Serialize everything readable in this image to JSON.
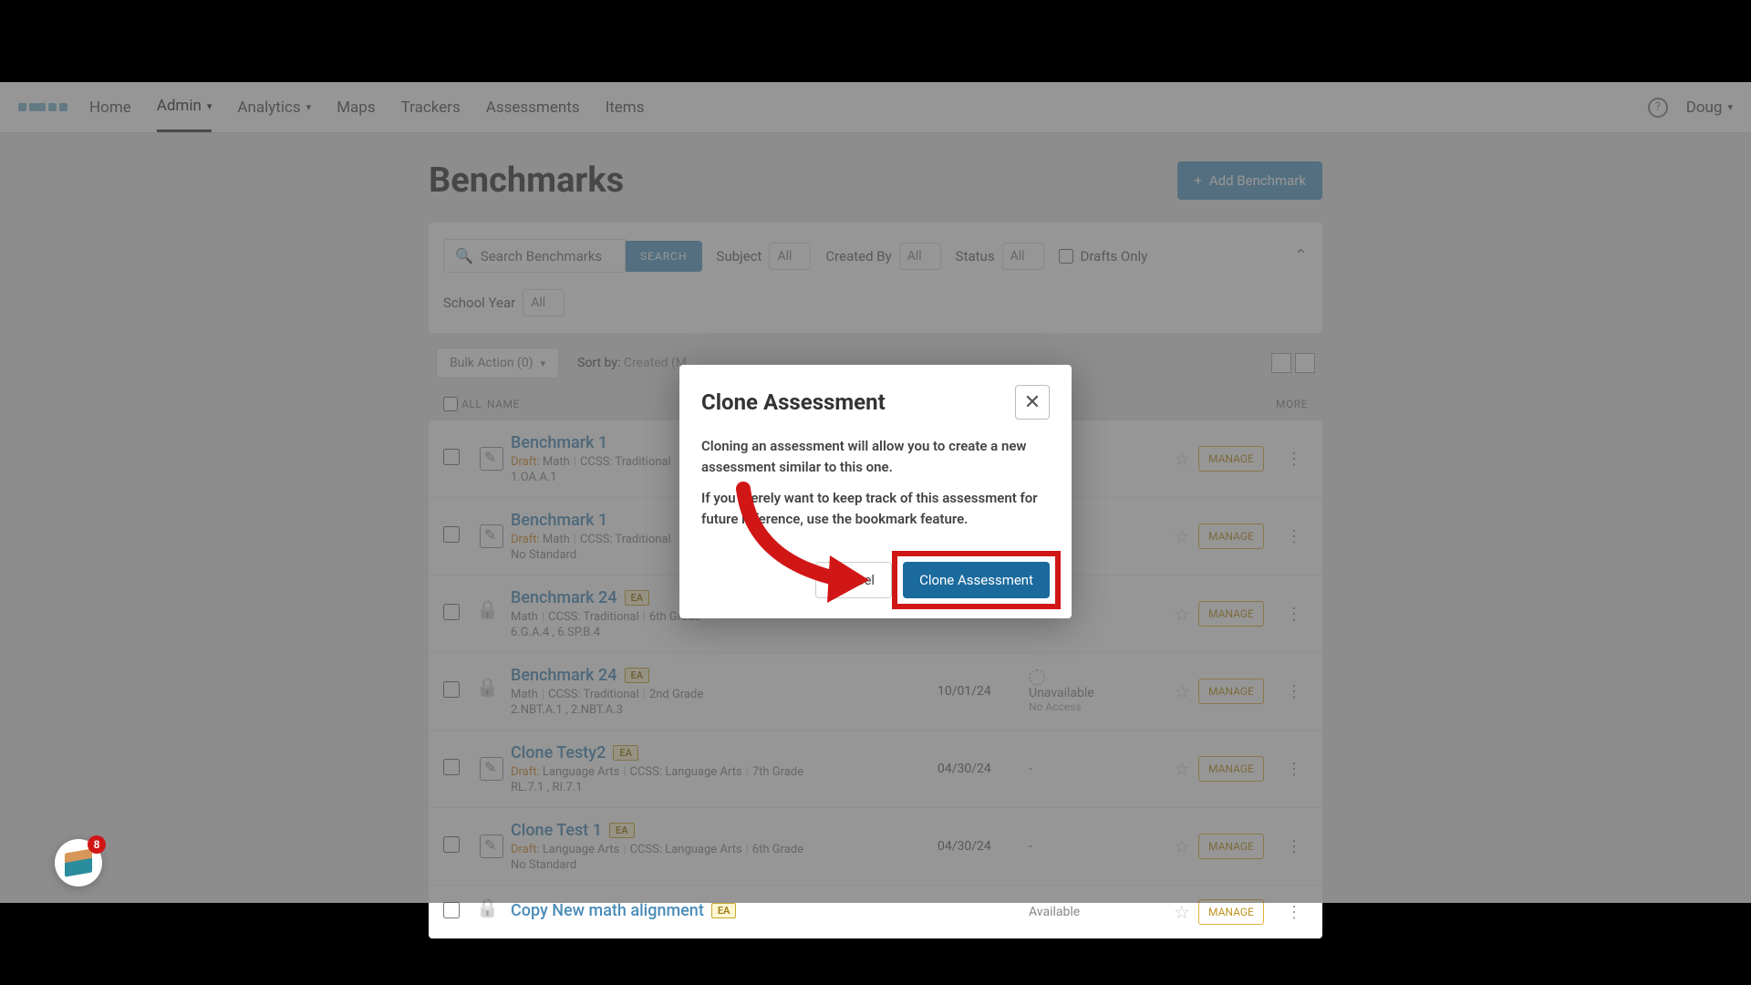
{
  "nav": {
    "items": [
      "Home",
      "Admin",
      "Analytics",
      "Maps",
      "Trackers",
      "Assessments",
      "Items"
    ],
    "activeIndex": 1,
    "user": "Doug"
  },
  "page": {
    "title": "Benchmarks",
    "addButton": "Add Benchmark"
  },
  "filters": {
    "searchPlaceholder": "Search Benchmarks",
    "searchButton": "SEARCH",
    "subjectLabel": "Subject",
    "subjectValue": "All",
    "createdByLabel": "Created By",
    "createdByValue": "All",
    "statusLabel": "Status",
    "statusValue": "All",
    "draftsOnly": "Drafts Only",
    "schoolYearLabel": "School Year",
    "schoolYearValue": "All"
  },
  "actionbar": {
    "bulkAction": "Bulk Action (0)",
    "sortByLabel": "Sort by:",
    "sortByValue": "Created (M..."
  },
  "tableHeader": {
    "all": "ALL",
    "name": "NAME",
    "more": "MORE"
  },
  "rows": [
    {
      "title": "Benchmark 1",
      "draft": true,
      "ea": false,
      "meta": "Math",
      "ccss": "CCSS: Traditional",
      "grade": "",
      "tags": "1.OA.A.1",
      "date": "",
      "status": "",
      "lockIcon": false
    },
    {
      "title": "Benchmark 1",
      "draft": true,
      "ea": false,
      "meta": "Math",
      "ccss": "CCSS: Traditional",
      "grade": "",
      "tags": "No Standard",
      "date": "",
      "status": "",
      "lockIcon": false
    },
    {
      "title": "Benchmark 24",
      "draft": false,
      "ea": true,
      "meta": "Math",
      "ccss": "CCSS: Traditional",
      "grade": "6th Grade",
      "tags": "6.G.A.4 , 6.SP.B.4",
      "date": "",
      "status": "",
      "lockIcon": true
    },
    {
      "title": "Benchmark 24",
      "draft": false,
      "ea": true,
      "meta": "Math",
      "ccss": "CCSS: Traditional",
      "grade": "2nd Grade",
      "tags": "2.NBT.A.1 , 2.NBT.A.3",
      "date": "10/01/24",
      "status": "Unavailable",
      "statusSub": "No Access",
      "lockIcon": true
    },
    {
      "title": "Clone Testy2",
      "draft": true,
      "ea": true,
      "meta": "Language Arts",
      "ccss": "CCSS: Language Arts",
      "grade": "7th Grade",
      "tags": "RL.7.1 , RI.7.1",
      "date": "04/30/24",
      "status": "-",
      "lockIcon": false
    },
    {
      "title": "Clone Test 1",
      "draft": true,
      "ea": true,
      "meta": "Language Arts",
      "ccss": "CCSS: Language Arts",
      "grade": "6th Grade",
      "tags": "No Standard",
      "date": "04/30/24",
      "status": "-",
      "lockIcon": false
    },
    {
      "title": "Copy New math alignment",
      "draft": false,
      "ea": true,
      "meta": "",
      "ccss": "",
      "grade": "",
      "tags": "",
      "date": "",
      "status": "Available",
      "lockIcon": true
    }
  ],
  "common": {
    "draftLabel": "Draft:",
    "eaLabel": "EA",
    "manage": "MANAGE"
  },
  "modal": {
    "title": "Clone Assessment",
    "body1": "Cloning an assessment will allow you to create a new assessment similar to this one.",
    "body2": "If you merely want to keep track of this assessment for future reference, use the bookmark feature.",
    "cancel": "Cancel",
    "confirm": "Clone Assessment"
  },
  "floatBadge": {
    "count": "8"
  }
}
